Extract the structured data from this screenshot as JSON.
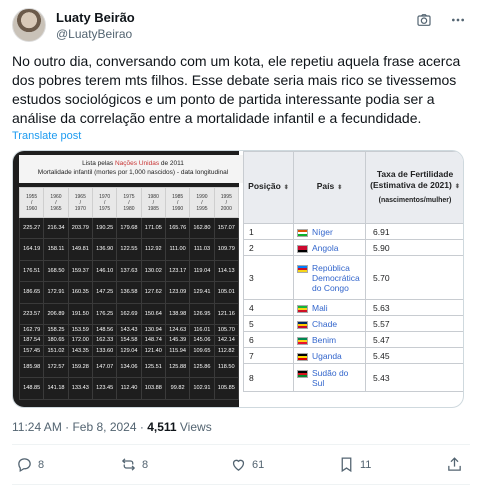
{
  "author": {
    "name": "Luaty Beirão",
    "handle": "@LuatyBeirao"
  },
  "tweet": {
    "text": "No outro dia, conversando com um kota, ele repetiu aquela frase acerca dos pobres terem mts filhos. Esse debate seria mais rico se tivessemos estudos sociológicos e um ponto de partida interessante podia ser a análise da correlação entre a mortalidade infantil e a fecundidade.",
    "translate_label": "Translate post"
  },
  "mortality_table": {
    "title_prefix": "Lista pelas ",
    "title_org": "Nações Unidas",
    "title_suffix": " de 2011",
    "subtitle": "Mortalidade infantil (mortes por 1,000 nascidos) - data longitudinal",
    "headers": [
      [
        "1955",
        "/",
        "1960"
      ],
      [
        "1960",
        "/",
        "1965"
      ],
      [
        "1965",
        "/",
        "1970"
      ],
      [
        "1970",
        "/",
        "1975"
      ],
      [
        "1975",
        "/",
        "1980"
      ],
      [
        "1980",
        "/",
        "1985"
      ],
      [
        "1985",
        "/",
        "1990"
      ],
      [
        "1990",
        "/",
        "1995"
      ],
      [
        "1995",
        "/",
        "2000"
      ]
    ],
    "rows": [
      [
        "225.27",
        "216.34",
        "203.79",
        "190.25",
        "179.68",
        "171.05",
        "165.76",
        "162.80",
        "157.07"
      ],
      [
        "164.19",
        "158.11",
        "149.81",
        "136.90",
        "122.55",
        "112.92",
        "111.00",
        "111.03",
        "109.79"
      ],
      [
        "176.51",
        "168.50",
        "159.37",
        "146.10",
        "137.63",
        "130.02",
        "123.17",
        "119.04",
        "114.13"
      ],
      [
        "186.65",
        "172.91",
        "160.35",
        "147.25",
        "136.58",
        "127.62",
        "123.09",
        "129.41",
        "105.01"
      ],
      [
        "223.57",
        "206.89",
        "191.50",
        "176.25",
        "162.69",
        "150.64",
        "138.98",
        "126.95",
        "121.16"
      ],
      [
        "162.79",
        "158.25",
        "153.59",
        "148.56",
        "143.43",
        "130.94",
        "124.63",
        "116.01",
        "105.70"
      ],
      [
        "187.54",
        "180.65",
        "172.00",
        "162.33",
        "154.58",
        "148.74",
        "145.39",
        "145.06",
        "142.14"
      ],
      [
        "157.45",
        "151.02",
        "143.35",
        "133.60",
        "129.04",
        "121.40",
        "115.94",
        "109.65",
        "112.82"
      ],
      [
        "185.98",
        "172.57",
        "159.28",
        "147.07",
        "134.06",
        "125.51",
        "125.88",
        "125.86",
        "118.50"
      ],
      [
        "148.85",
        "141.18",
        "133.43",
        "123.45",
        "112.40",
        "103.88",
        "99.82",
        "102.91",
        "105.85"
      ]
    ]
  },
  "fertility_table": {
    "headers": {
      "position": "Posição",
      "country": "País",
      "rate": "Taxa de Fertilidade (Estimativa de 2021)",
      "rate_sub": "(nascimentos/mulher)"
    },
    "sort_icon": "⬍",
    "rows": [
      {
        "pos": "1",
        "country": "Níger",
        "value": "6.91",
        "flag": [
          "#e05206",
          "#ffffff",
          "#0db02b"
        ]
      },
      {
        "pos": "2",
        "country": "Angola",
        "value": "5.90",
        "flag": [
          "#cc092f",
          "#cc092f",
          "#000000"
        ]
      },
      {
        "pos": "3",
        "country": "República Democrática do Congo",
        "value": "5.70",
        "flag": [
          "#007fff",
          "#ce1021",
          "#f7d618"
        ]
      },
      {
        "pos": "4",
        "country": "Mali",
        "value": "5.63",
        "flag": [
          "#14b53a",
          "#fcd116",
          "#ce1126"
        ]
      },
      {
        "pos": "5",
        "country": "Chade",
        "value": "5.57",
        "flag": [
          "#002664",
          "#fecb00",
          "#c60c30"
        ]
      },
      {
        "pos": "6",
        "country": "Benim",
        "value": "5.47",
        "flag": [
          "#008751",
          "#fcd116",
          "#e8112d"
        ]
      },
      {
        "pos": "7",
        "country": "Uganda",
        "value": "5.45",
        "flag": [
          "#000000",
          "#fcdc04",
          "#d90000"
        ]
      },
      {
        "pos": "8",
        "country": "Sudão do Sul",
        "value": "5.43",
        "flag": [
          "#000000",
          "#da121a",
          "#078930"
        ]
      }
    ]
  },
  "meta": {
    "time": "11:24 AM · Feb 8, 2024 · ",
    "views_count": "4,511",
    "views_label": " Views"
  },
  "actions": {
    "replies": "8",
    "reposts": "8",
    "likes": "61",
    "bookmarks": "11"
  },
  "icons": {
    "camera": "camera-icon",
    "more": "more-icon",
    "reply": "reply-icon",
    "repost": "repost-icon",
    "like": "like-icon",
    "bookmark": "bookmark-icon",
    "share": "share-icon"
  }
}
